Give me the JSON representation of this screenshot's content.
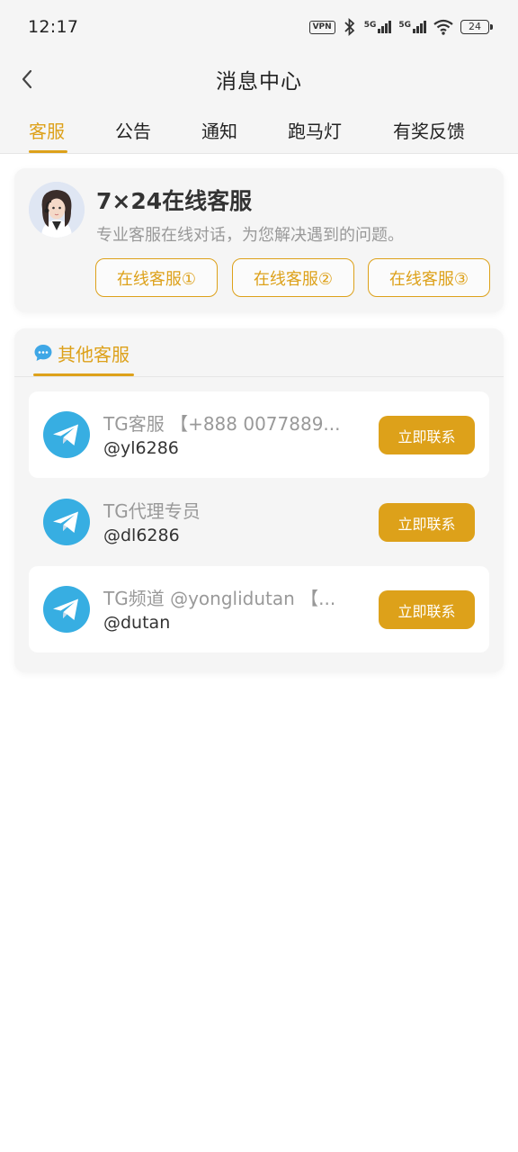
{
  "status_bar": {
    "time": "12:17",
    "vpn": "VPN",
    "network_1": "5G",
    "network_2": "5G",
    "battery": "24"
  },
  "header": {
    "title": "消息中心"
  },
  "tabs": [
    {
      "label": "客服",
      "active": true
    },
    {
      "label": "公告",
      "active": false
    },
    {
      "label": "通知",
      "active": false
    },
    {
      "label": "跑马灯",
      "active": false
    },
    {
      "label": "有奖反馈",
      "active": false
    }
  ],
  "online_service": {
    "title": "7×24在线客服",
    "description": "专业客服在线对话，为您解决遇到的问题。",
    "buttons": [
      "在线客服①",
      "在线客服②",
      "在线客服③"
    ]
  },
  "other_service": {
    "title": "其他客服",
    "contacts": [
      {
        "name": "TG客服 【+888 0077889...",
        "handle": "@yl6286",
        "action": "立即联系"
      },
      {
        "name": "TG代理专员",
        "handle": "@dl6286",
        "action": "立即联系"
      },
      {
        "name": "TG频道 @yonglidutan 【...",
        "handle": "@dutan",
        "action": "立即联系"
      }
    ]
  },
  "colors": {
    "accent": "#dda11a",
    "background": "#f5f5f5",
    "telegram": "#37aee2"
  }
}
